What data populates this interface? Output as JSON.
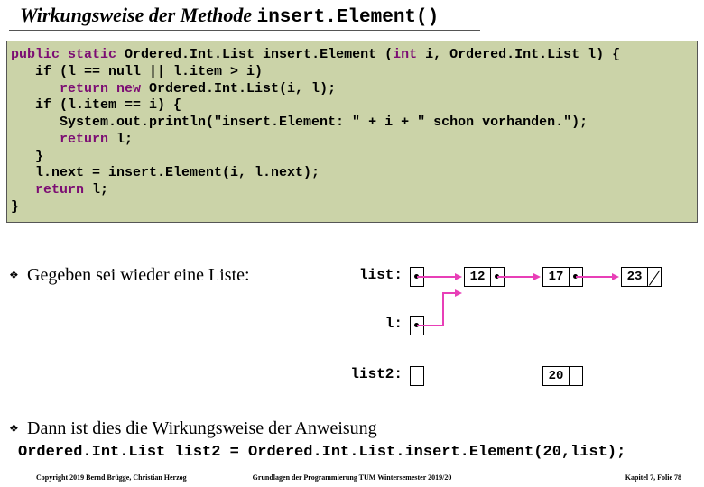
{
  "title": {
    "text_prefix": "Wirkungsweise der Methode ",
    "code": "insert.Element()"
  },
  "code": {
    "lines": [
      {
        "plain_before": "",
        "kw": "public static",
        "plain_mid": " Ordered.Int.List insert.Element (",
        "kw2": "int",
        "plain_after": " i, Ordered.Int.List l) {"
      },
      {
        "plain": "   if (l == null || l.item > i)"
      },
      {
        "plain_before": "      ",
        "kw": "return new",
        "plain_after": " Ordered.Int.List(i, l);"
      },
      {
        "plain": "   if (l.item == i) {"
      },
      {
        "plain": "      System.out.println(\"insert.Element: \" + i + \" schon vorhanden.\");"
      },
      {
        "plain_before": "      ",
        "kw": "return",
        "plain_after": " l;"
      },
      {
        "plain": "   }"
      },
      {
        "plain": "   l.next = insert.Element(i, l.next);"
      },
      {
        "plain_before": "   ",
        "kw": "return",
        "plain_after": " l;"
      },
      {
        "plain": "}"
      }
    ]
  },
  "bullets": {
    "b1": "Gegeben sei wieder eine Liste:",
    "b2": "Dann ist dies die Wirkungsweise der Anweisung"
  },
  "inline_code": "Ordered.Int.List list2 = Ordered.Int.List.insert.Element(20,list);",
  "diagram": {
    "labels": {
      "list": "list:",
      "l": "l:",
      "list2": "list2:"
    },
    "nodes": {
      "n1": "12",
      "n2": "17",
      "n3": "23",
      "n4": "20"
    }
  },
  "footer": {
    "left": "Copyright 2019 Bernd Brügge, Christian Herzog",
    "center": "Grundlagen der Programmierung TUM Wintersemester 2019/20",
    "right": "Kapitel 7, Folie 78"
  }
}
